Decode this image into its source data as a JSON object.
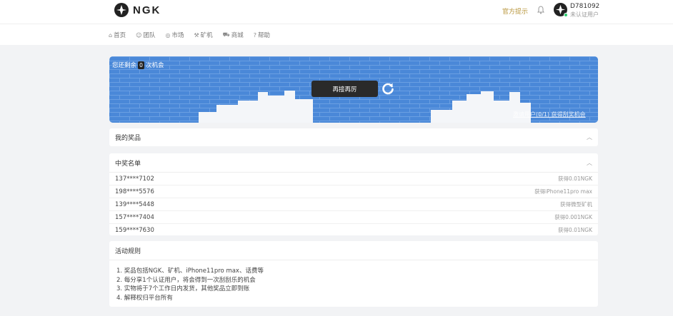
{
  "header": {
    "brand": "NGK",
    "official_notice": "官方提示",
    "user_id": "D781092",
    "user_status": "未认证用户"
  },
  "nav": {
    "items": [
      {
        "icon": "home-icon",
        "label": "首页"
      },
      {
        "icon": "team-icon",
        "label": "团队"
      },
      {
        "icon": "market-icon",
        "label": "市场"
      },
      {
        "icon": "miner-icon",
        "label": "矿机"
      },
      {
        "icon": "cart-icon",
        "label": "商城"
      },
      {
        "icon": "help-icon",
        "label": "帮助"
      }
    ]
  },
  "scratch": {
    "remain_prefix": "您还剩余",
    "remain_count": "0",
    "remain_suffix": "次机会",
    "again_label": "再接再厉",
    "invite_text": "邀请用户(0/1) 获得刮奖机会"
  },
  "my_prizes": {
    "title": "我的奖品"
  },
  "winners": {
    "title": "中奖名单",
    "rows": [
      {
        "phone": "137****7102",
        "prize": "获得0.01NGK"
      },
      {
        "phone": "198****5576",
        "prize": "获得iPhone11pro max"
      },
      {
        "phone": "139****5448",
        "prize": "获得微型矿机"
      },
      {
        "phone": "157****7404",
        "prize": "获得0.001NGK"
      },
      {
        "phone": "159****7630",
        "prize": "获得0.01NGK"
      }
    ]
  },
  "rules": {
    "title": "活动规则",
    "items": [
      "1. 奖品包括NGK、矿机、iPhone11pro max、话费等",
      "2. 每分享1个认证用户，将会得到一次刮刮乐的机会",
      "3. 实物将于7个工作日内发货，其他奖品立即到账",
      "4. 解释权归平台所有"
    ]
  },
  "colors": {
    "scratch_blue": "#4a88d8",
    "accent_gold": "#b8963c",
    "online_green": "#2ecc71"
  }
}
